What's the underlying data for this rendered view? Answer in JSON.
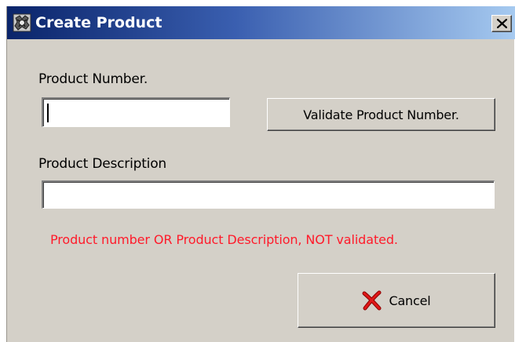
{
  "window": {
    "title": "Create Product",
    "close_label": "Close",
    "icons": {
      "app": "app-icon",
      "close": "close-icon"
    },
    "colors": {
      "titlebar_start": "#0a246a",
      "titlebar_end": "#a6caf0",
      "dialog_background": "#d4d0c8"
    }
  },
  "form": {
    "product_number": {
      "label": "Product Number.",
      "value": "",
      "placeholder": ""
    },
    "validate_button": {
      "label": "Validate Product Number."
    },
    "product_description": {
      "label": "Product Description",
      "value": "",
      "placeholder": ""
    },
    "validation_message": {
      "text": "Product number OR Product Description, NOT validated.",
      "color": "#ff1a2a"
    },
    "cancel_button": {
      "label": "Cancel",
      "icon": "red-x-icon"
    }
  }
}
